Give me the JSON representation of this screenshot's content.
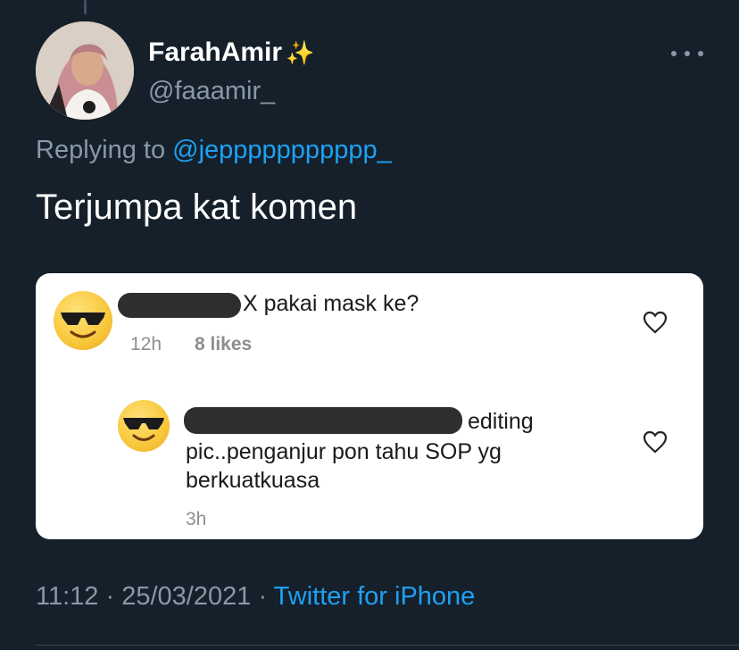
{
  "tweet": {
    "display_name": "FarahAmir",
    "sparkle_emoji": "✨",
    "handle": "@faaamir_",
    "replying_prefix": "Replying to",
    "replying_to": "@jeppppppppppp_",
    "text": "Terjumpa kat komen",
    "time": "11:12",
    "date": "25/03/2021",
    "separator": "·",
    "source": "Twitter for iPhone"
  },
  "attached_screenshot": {
    "comments": [
      {
        "text": "X pakai mask ke?",
        "age": "12h",
        "likes": "8 likes",
        "avatar_icon": "sunglasses-emoji-icon"
      },
      {
        "text_line1": "editing",
        "text_line2": "pic..penganjur pon tahu SOP yg",
        "text_line3": "berkuatkuasa",
        "age": "3h",
        "avatar_icon": "sunglasses-emoji-icon"
      }
    ]
  },
  "colors": {
    "background": "#15202b",
    "muted_text": "#8899a6",
    "link": "#1da1f2",
    "card": "#ffffff"
  }
}
